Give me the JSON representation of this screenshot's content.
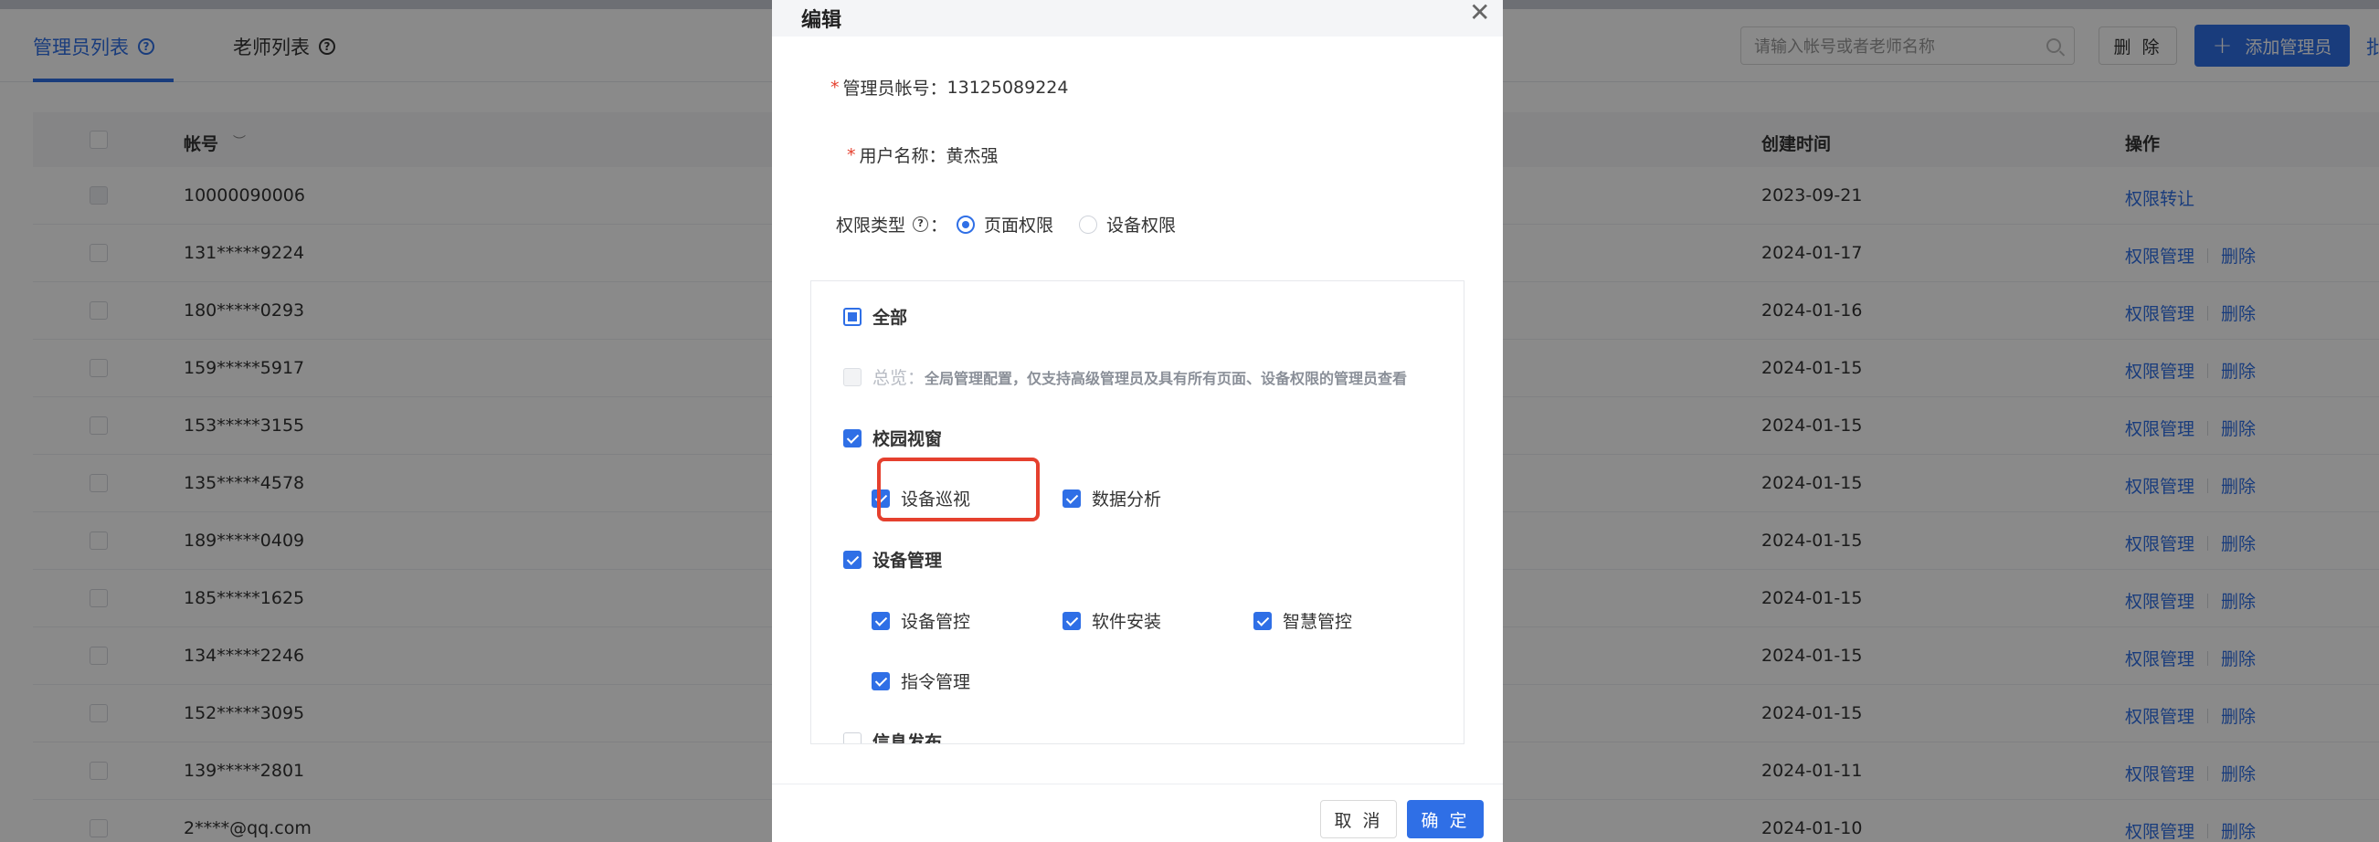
{
  "tabs": [
    {
      "label": "管理员列表",
      "active": true
    },
    {
      "label": "老师列表",
      "active": false
    }
  ],
  "toolbar": {
    "search_placeholder": "请输入帐号或者老师名称",
    "delete_label": "删 除",
    "add_label": "添加管理员",
    "edge_text": "批"
  },
  "table": {
    "headers": {
      "account": "帐号",
      "created": "创建时间",
      "ops": "操作"
    },
    "rows": [
      {
        "account": "10000090006",
        "created": "2023-09-21",
        "ops": [
          "权限转让"
        ]
      },
      {
        "account": "131*****9224",
        "created": "2024-01-17",
        "ops": [
          "权限管理",
          "删除"
        ]
      },
      {
        "account": "180*****0293",
        "created": "2024-01-16",
        "ops": [
          "权限管理",
          "删除"
        ]
      },
      {
        "account": "159*****5917",
        "created": "2024-01-15",
        "ops": [
          "权限管理",
          "删除"
        ]
      },
      {
        "account": "153*****3155",
        "created": "2024-01-15",
        "ops": [
          "权限管理",
          "删除"
        ]
      },
      {
        "account": "135*****4578",
        "created": "2024-01-15",
        "ops": [
          "权限管理",
          "删除"
        ]
      },
      {
        "account": "189*****0409",
        "created": "2024-01-15",
        "ops": [
          "权限管理",
          "删除"
        ]
      },
      {
        "account": "185*****1625",
        "created": "2024-01-15",
        "ops": [
          "权限管理",
          "删除"
        ]
      },
      {
        "account": "134*****2246",
        "created": "2024-01-15",
        "ops": [
          "权限管理",
          "删除"
        ]
      },
      {
        "account": "152*****3095",
        "created": "2024-01-15",
        "ops": [
          "权限管理",
          "删除"
        ]
      },
      {
        "account": "139*****2801",
        "created": "2024-01-11",
        "ops": [
          "权限管理",
          "删除"
        ]
      },
      {
        "account": "2****@qq.com",
        "created": "2024-01-10",
        "ops": [
          "权限管理",
          "删除"
        ]
      }
    ]
  },
  "modal": {
    "title": "编辑",
    "account_label": "管理员帐号：",
    "account_value": "13125089224",
    "username_label": "用户名称：",
    "username_value": "黄杰强",
    "perm_type_label": "权限类型",
    "perm_type_colon": "：",
    "perm_options": [
      "页面权限",
      "设备权限"
    ],
    "perm_selected": "页面权限",
    "perm_tree": {
      "all": "全部",
      "overview_label": "总览：",
      "overview_desc": "全局管理配置，仅支持高级管理员及具有所有页面、设备权限的管理员查看",
      "campus": "校园视窗",
      "campus_children": [
        "设备巡视",
        "数据分析"
      ],
      "device_mgmt": "设备管理",
      "device_children": [
        "设备管控",
        "软件安装",
        "智慧管控",
        "指令管理"
      ],
      "info_publish": "信息发布"
    },
    "cancel_label": "取 消",
    "ok_label": "确 定"
  },
  "colors": {
    "primary": "#2f6fe6",
    "danger": "#e5402e",
    "overlay": "rgba(0,0,0,0.46)"
  }
}
